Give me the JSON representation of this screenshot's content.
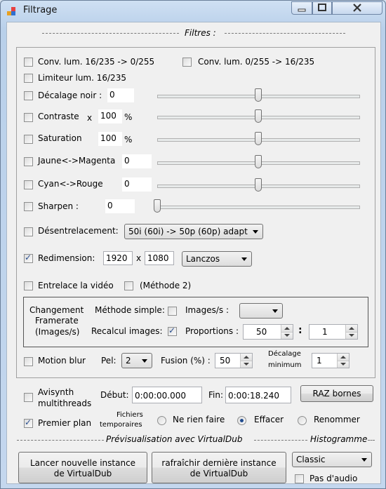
{
  "window": {
    "title": "Filtrage",
    "icon": "app-window-icon",
    "controls": [
      "minimize-icon",
      "maximize-icon",
      "close-icon"
    ]
  },
  "sections": {
    "filtres": "Filtres :",
    "previsualisation": "Prévisualisation avec VirtualDub",
    "histogramme": "Histogramme"
  },
  "filters": {
    "conv_16_0": {
      "label": "Conv. lum. 16/235 -> 0/255",
      "checked": false
    },
    "conv_0_16": {
      "label": "Conv. lum. 0/255 -> 16/235",
      "checked": false
    },
    "limiteur": {
      "label": "Limiteur lum. 16/235",
      "checked": false
    },
    "decalage_noir": {
      "label": "Décalage noir :",
      "value": "0",
      "checked": false
    },
    "contraste": {
      "label": "Contraste",
      "prefix": "x",
      "value": "100",
      "unit": "%",
      "checked": false
    },
    "saturation": {
      "label": "Saturation",
      "value": "100",
      "unit": "%",
      "checked": false
    },
    "jaune_magenta": {
      "label": "Jaune<->Magenta",
      "value": "0",
      "checked": false
    },
    "cyan_rouge": {
      "label": "Cyan<->Rouge",
      "value": "0",
      "checked": false
    },
    "sharpen": {
      "label": "Sharpen :",
      "value": "0",
      "checked": false
    }
  },
  "sliders": {
    "decalage_noir": 0.5,
    "contraste": 0.5,
    "saturation": 0.5,
    "jaune_magenta": 0.5,
    "cyan_rouge": 0.5,
    "sharpen": 0.0
  },
  "desentrelacement": {
    "label": "Désentrelacement:",
    "selected": "50i (60i) -> 50p (60p) adapt",
    "checked": false
  },
  "redimension": {
    "label": "Redimension:",
    "width": "1920",
    "x": "x",
    "height": "1080",
    "method": "Lanczos",
    "checked": true
  },
  "entrelace": {
    "label": "Entrelace la vidéo",
    "checked": false,
    "methode2_label": "(Méthode 2)",
    "methode2_checked": false
  },
  "framerate": {
    "title_line1": "Changement",
    "title_line2": "Framerate",
    "title_line3": "(Images/s)",
    "methode_simple_label": "Méthode simple:",
    "methode_simple_checked": false,
    "images_s_label": "Images/s :",
    "images_s_selected": "",
    "recalcul_label": "Recalcul images:",
    "recalcul_checked": true,
    "proportions_label": "Proportions :",
    "prop_a": "50",
    "colon": ":",
    "prop_b": "1"
  },
  "motion_blur": {
    "label": "Motion blur",
    "checked": false,
    "pel_label": "Pel:",
    "pel_selected": "2",
    "fusion_label": "Fusion (%) :",
    "fusion_value": "50",
    "decalage_label_1": "Décalage",
    "decalage_label_2": "minimum",
    "decalage_value": "1"
  },
  "bottom": {
    "avisynth_label_1": "Avisynth",
    "avisynth_label_2": "multithreads",
    "avisynth_checked": false,
    "debut_label": "Début:",
    "debut_value": "0:00:00.000",
    "fin_label": "Fin:",
    "fin_value": "0:00:18.240",
    "raz_button": "RAZ bornes",
    "premier_plan_label": "Premier plan",
    "premier_plan_checked": true,
    "fichiers_label_1": "Fichiers",
    "fichiers_label_2": "temporaires",
    "radio_ne_rien_faire": "Ne rien faire",
    "radio_effacer": "Effacer",
    "radio_renommer": "Renommer",
    "radio_selected": "effacer",
    "lancer_button_1": "Lancer nouvelle instance",
    "lancer_button_2": "de VirtualDub",
    "rafraichir_button_1": "rafraîchir dernière instance",
    "rafraichir_button_2": "de VirtualDub",
    "histogramme_selected": "Classic",
    "pas_audio_label": "Pas d'audio",
    "pas_audio_checked": false
  }
}
